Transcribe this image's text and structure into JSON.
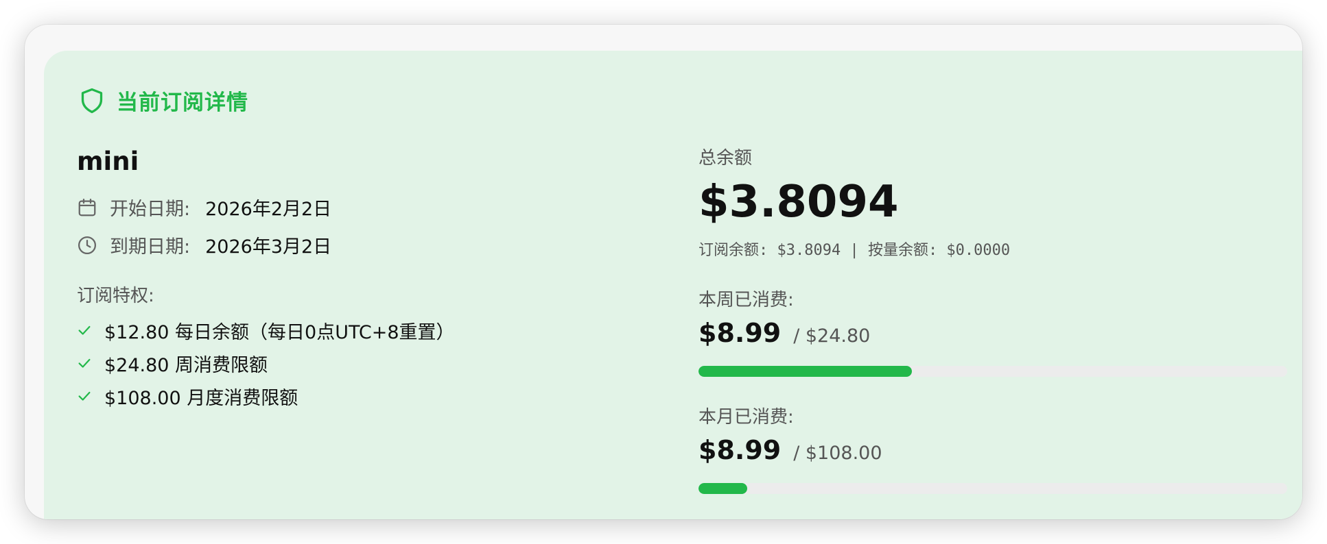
{
  "header": {
    "title": "当前订阅详情",
    "icon": "shield-icon",
    "accent_color": "#22b84a"
  },
  "plan": {
    "name": "mini",
    "start_label": "开始日期:",
    "start_value": "2026年2月2日",
    "end_label": "到期日期:",
    "end_value": "2026年3月2日"
  },
  "perks": {
    "label": "订阅特权:",
    "items": [
      "$12.80 每日余额（每日0点UTC+8重置）",
      "$24.80 周消费限额",
      "$108.00 月度消费限额"
    ]
  },
  "balance": {
    "label": "总余额",
    "total": "$3.8094",
    "breakdown": "订阅余额: $3.8094 | 按量余额: $0.0000"
  },
  "weekly": {
    "label": "本周已消费:",
    "spent": "$8.99",
    "limit": "/ $24.80",
    "progress": 0.3625
  },
  "monthly": {
    "label": "本月已消费:",
    "spent": "$8.99",
    "limit": "/ $108.00",
    "progress": 0.083
  }
}
